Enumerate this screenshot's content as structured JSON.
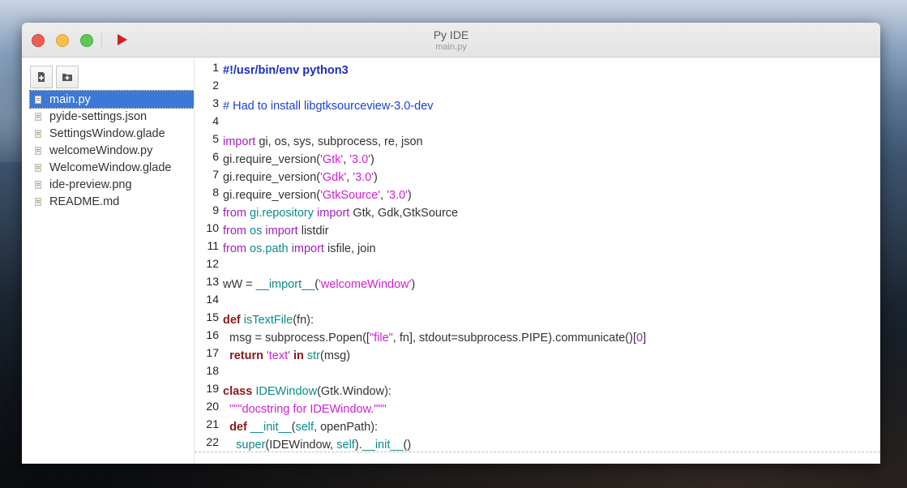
{
  "window": {
    "title": "Py IDE",
    "subtitle": "main.py"
  },
  "toolbar": {
    "close": "close",
    "minimize": "minimize",
    "maximize": "maximize",
    "run_icon": "play-icon"
  },
  "sidebar": {
    "new_file_icon": "new-file-icon",
    "new_folder_icon": "new-folder-icon",
    "files": [
      "main.py",
      "pyide-settings.json",
      "SettingsWindow.glade",
      "welcomeWindow.py",
      "WelcomeWindow.glade",
      "ide-preview.png",
      "README.md"
    ],
    "selected_index": 0
  },
  "editor": {
    "line_numbers": [
      "1",
      "2",
      "3",
      "4",
      "5",
      "6",
      "7",
      "8",
      "9",
      "10",
      "11",
      "12",
      "13",
      "14",
      "15",
      "16",
      "17",
      "18",
      "19",
      "20",
      "21",
      "22"
    ],
    "lines": [
      {
        "t": [
          [
            "cb",
            "#!/usr/bin/env python3"
          ]
        ]
      },
      {
        "t": []
      },
      {
        "t": [
          [
            "c",
            "# Had to install libgtksourceview-3.0-dev"
          ]
        ]
      },
      {
        "t": []
      },
      {
        "t": [
          [
            "p",
            "import"
          ],
          [
            "n",
            " gi, os, sys, subprocess, re, json"
          ]
        ]
      },
      {
        "t": [
          [
            "n",
            "gi.require_version("
          ],
          [
            "s",
            "'Gtk'"
          ],
          [
            "n",
            ", "
          ],
          [
            "s",
            "'3.0'"
          ],
          [
            "n",
            ")"
          ]
        ]
      },
      {
        "t": [
          [
            "n",
            "gi.require_version("
          ],
          [
            "s",
            "'Gdk'"
          ],
          [
            "n",
            ", "
          ],
          [
            "s",
            "'3.0'"
          ],
          [
            "n",
            ")"
          ]
        ]
      },
      {
        "t": [
          [
            "n",
            "gi.require_version("
          ],
          [
            "s",
            "'GtkSource'"
          ],
          [
            "n",
            ", "
          ],
          [
            "s",
            "'3.0'"
          ],
          [
            "n",
            ")"
          ]
        ]
      },
      {
        "t": [
          [
            "p",
            "from"
          ],
          [
            "n",
            " "
          ],
          [
            "b",
            "gi.repository"
          ],
          [
            "n",
            " "
          ],
          [
            "p",
            "import"
          ],
          [
            "n",
            " Gtk, Gdk,GtkSource"
          ]
        ]
      },
      {
        "t": [
          [
            "p",
            "from"
          ],
          [
            "n",
            " "
          ],
          [
            "b",
            "os"
          ],
          [
            "n",
            " "
          ],
          [
            "p",
            "import"
          ],
          [
            "n",
            " listdir"
          ]
        ]
      },
      {
        "t": [
          [
            "p",
            "from"
          ],
          [
            "n",
            " "
          ],
          [
            "b",
            "os.path"
          ],
          [
            "n",
            " "
          ],
          [
            "p",
            "import"
          ],
          [
            "n",
            " isfile, join"
          ]
        ]
      },
      {
        "t": []
      },
      {
        "t": [
          [
            "n",
            "wW = "
          ],
          [
            "b",
            "__import__"
          ],
          [
            "n",
            "("
          ],
          [
            "s",
            "'welcomeWindow'"
          ],
          [
            "n",
            ")"
          ]
        ]
      },
      {
        "t": []
      },
      {
        "t": [
          [
            "k",
            "def"
          ],
          [
            "n",
            " "
          ],
          [
            "b",
            "isTextFile"
          ],
          [
            "n",
            "(fn):"
          ]
        ]
      },
      {
        "t": [
          [
            "n",
            "  msg = subprocess.Popen(["
          ],
          [
            "s",
            "\"file\""
          ],
          [
            "n",
            ", fn], stdout=subprocess.PIPE).communicate()["
          ],
          [
            "p",
            "0"
          ],
          [
            "n",
            "]"
          ]
        ]
      },
      {
        "t": [
          [
            "n",
            "  "
          ],
          [
            "k",
            "return"
          ],
          [
            "n",
            " "
          ],
          [
            "s",
            "'text'"
          ],
          [
            "n",
            " "
          ],
          [
            "k",
            "in"
          ],
          [
            "n",
            " "
          ],
          [
            "b",
            "str"
          ],
          [
            "n",
            "(msg)"
          ]
        ]
      },
      {
        "t": []
      },
      {
        "t": [
          [
            "k",
            "class"
          ],
          [
            "n",
            " "
          ],
          [
            "b",
            "IDEWindow"
          ],
          [
            "n",
            "(Gtk.Window):"
          ]
        ]
      },
      {
        "t": [
          [
            "n",
            "  "
          ],
          [
            "s",
            "\"\"\"docstring for IDEWindow.\"\"\""
          ]
        ]
      },
      {
        "t": [
          [
            "n",
            "  "
          ],
          [
            "k",
            "def"
          ],
          [
            "n",
            " "
          ],
          [
            "b",
            "__init__"
          ],
          [
            "n",
            "("
          ],
          [
            "b",
            "self"
          ],
          [
            "n",
            ", openPath):"
          ]
        ]
      },
      {
        "t": [
          [
            "n",
            "    "
          ],
          [
            "b",
            "super"
          ],
          [
            "n",
            "(IDEWindow, "
          ],
          [
            "b",
            "self"
          ],
          [
            "n",
            ")."
          ],
          [
            "b",
            "__init__"
          ],
          [
            "n",
            "()"
          ]
        ]
      }
    ]
  }
}
